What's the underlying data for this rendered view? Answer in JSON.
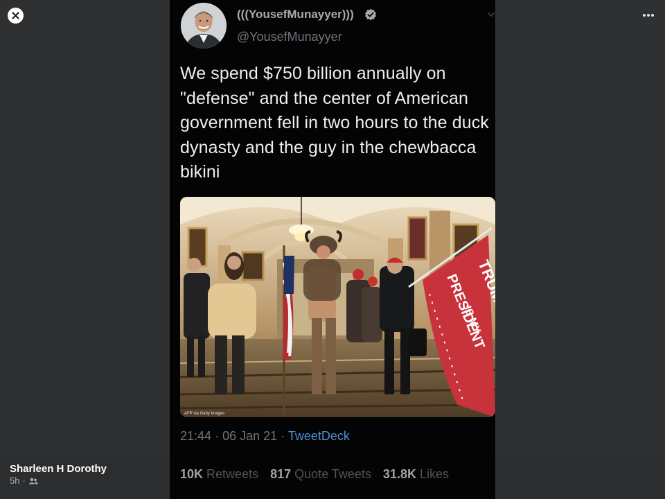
{
  "viewer": {
    "close_icon": "close-icon",
    "more_icon": "more-options-icon"
  },
  "tweet": {
    "display_name": "(((YousefMunayyer)))",
    "handle": "@YousefMunayyer",
    "verified_icon": "verified-badge-icon",
    "text": "We spend $750 billion annually on \"defense\" and the center of American government fell in two hours to the duck dynasty and the guy in the chewbacca bikini",
    "photo": {
      "flag_text_top": "TRUMP",
      "flag_text_mid": "IS MY",
      "flag_text_bottom": "PRESIDENT",
      "credit": "AFP via Getty Images"
    },
    "time": "21:44",
    "date": "06 Jan 21",
    "source": "TweetDeck",
    "stats": {
      "retweets_count": "10K",
      "retweets_label": "Retweets",
      "quotes_count": "817",
      "quotes_label": "Quote Tweets",
      "likes_count": "31.8K",
      "likes_label": "Likes"
    }
  },
  "footer": {
    "poster_name": "Sharleen H Dorothy",
    "post_time": "5h",
    "audience_icon": "friends-icon"
  },
  "colors": {
    "background": "#2f3031",
    "tweet_bg": "#040404",
    "link": "#4d8fd6",
    "muted": "#6e767d"
  }
}
